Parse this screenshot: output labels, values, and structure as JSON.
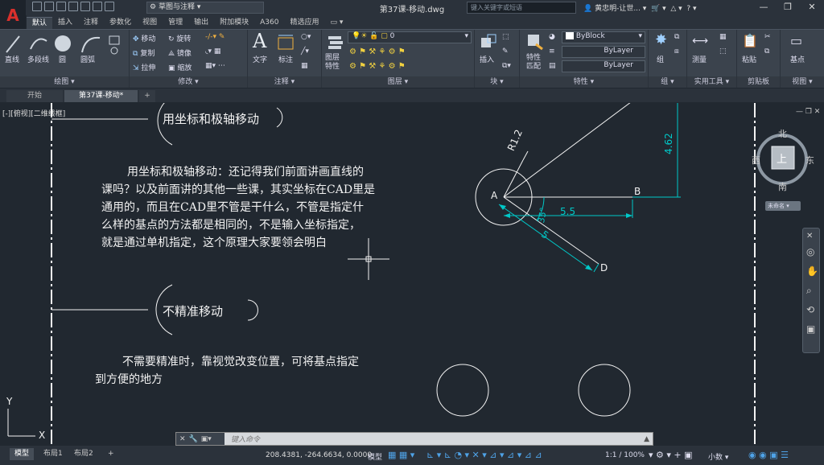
{
  "titlebar": {
    "app_letter": "A",
    "workspace": "草图与注释",
    "document_title": "第37课-移动.dwg",
    "search_placeholder": "键入关键字或短语",
    "user": "黄忠明-让世...",
    "window_controls": [
      "—",
      "❐",
      "✕"
    ]
  },
  "ribbon_tabs": [
    "默认",
    "插入",
    "注释",
    "参数化",
    "视图",
    "管理",
    "输出",
    "附加模块",
    "A360",
    "精选应用"
  ],
  "ribbon": {
    "draw": {
      "label": "绘图 ▾",
      "items": [
        "直线",
        "多段线",
        "圆",
        "圆弧"
      ]
    },
    "modify": {
      "label": "修改 ▾",
      "items": [
        "移动",
        "旋转",
        "复制",
        "镜像",
        "拉伸",
        "缩放"
      ]
    },
    "annotation": {
      "label": "注释 ▾",
      "items": [
        "文字",
        "标注"
      ]
    },
    "layers": {
      "label": "图层 ▾",
      "layer_props": "图层特性",
      "current_layer": "0"
    },
    "block": {
      "label": "块 ▾",
      "insert": "插入"
    },
    "properties": {
      "label": "特性 ▾",
      "match": "特性匹配",
      "color": "ByBlock",
      "linetype": "ByLayer",
      "lineweight": "ByLayer"
    },
    "groups": {
      "label": "组 ▾",
      "group": "组"
    },
    "utilities": {
      "label": "实用工具 ▾",
      "measure": "测量"
    },
    "clipboard": {
      "label": "剪贴板",
      "paste": "粘贴"
    },
    "view": {
      "label": "视图 ▾",
      "base": "基点"
    }
  },
  "doc_tabs": [
    "开始",
    "第37课-移动*",
    "+"
  ],
  "canvas": {
    "view_label": "[-][俯视][二维线框]",
    "heading1": "用坐标和极轴移动",
    "paragraph1": [
      "用坐标和极轴移动：还记得我们前面讲画直线的",
      "课吗？以及前面讲的其他一些课，其实坐标在CAD里是",
      "通用的，而且在CAD里不管是干什么，不管是指定什",
      "么样的基点的方法都是相同的，不是输入坐标指定，",
      "就是通过单机指定，这个原理大家要领会明白"
    ],
    "heading2": "不精准移动",
    "paragraph2": [
      "不需要精准时，靠视觉改变位置，可将基点指定",
      "到方便的地方"
    ],
    "drawing_labels": {
      "point_a": "A",
      "point_b": "B",
      "point_d": "D",
      "radius": "R1.2",
      "dim_462": "4.62",
      "dim_55": "5.5",
      "dim_35": "35°",
      "dim_5": "5"
    },
    "ucs_y": "Y",
    "ucs_x": "X",
    "compass": {
      "north": "北",
      "south": "南",
      "east": "东",
      "west": "西",
      "top": "上",
      "wcs": "未命名"
    }
  },
  "command": {
    "placeholder": "键入命令"
  },
  "status": {
    "layout_tabs": [
      "模型",
      "布局1",
      "布局2",
      "+"
    ],
    "coords": "208.4381, -264.6634, 0.0000",
    "model": "模型",
    "scale": "1:1 / 100%",
    "units": "小数"
  },
  "colors": {
    "cyan": "#00c8c8",
    "accent_red": "#d9302c"
  }
}
